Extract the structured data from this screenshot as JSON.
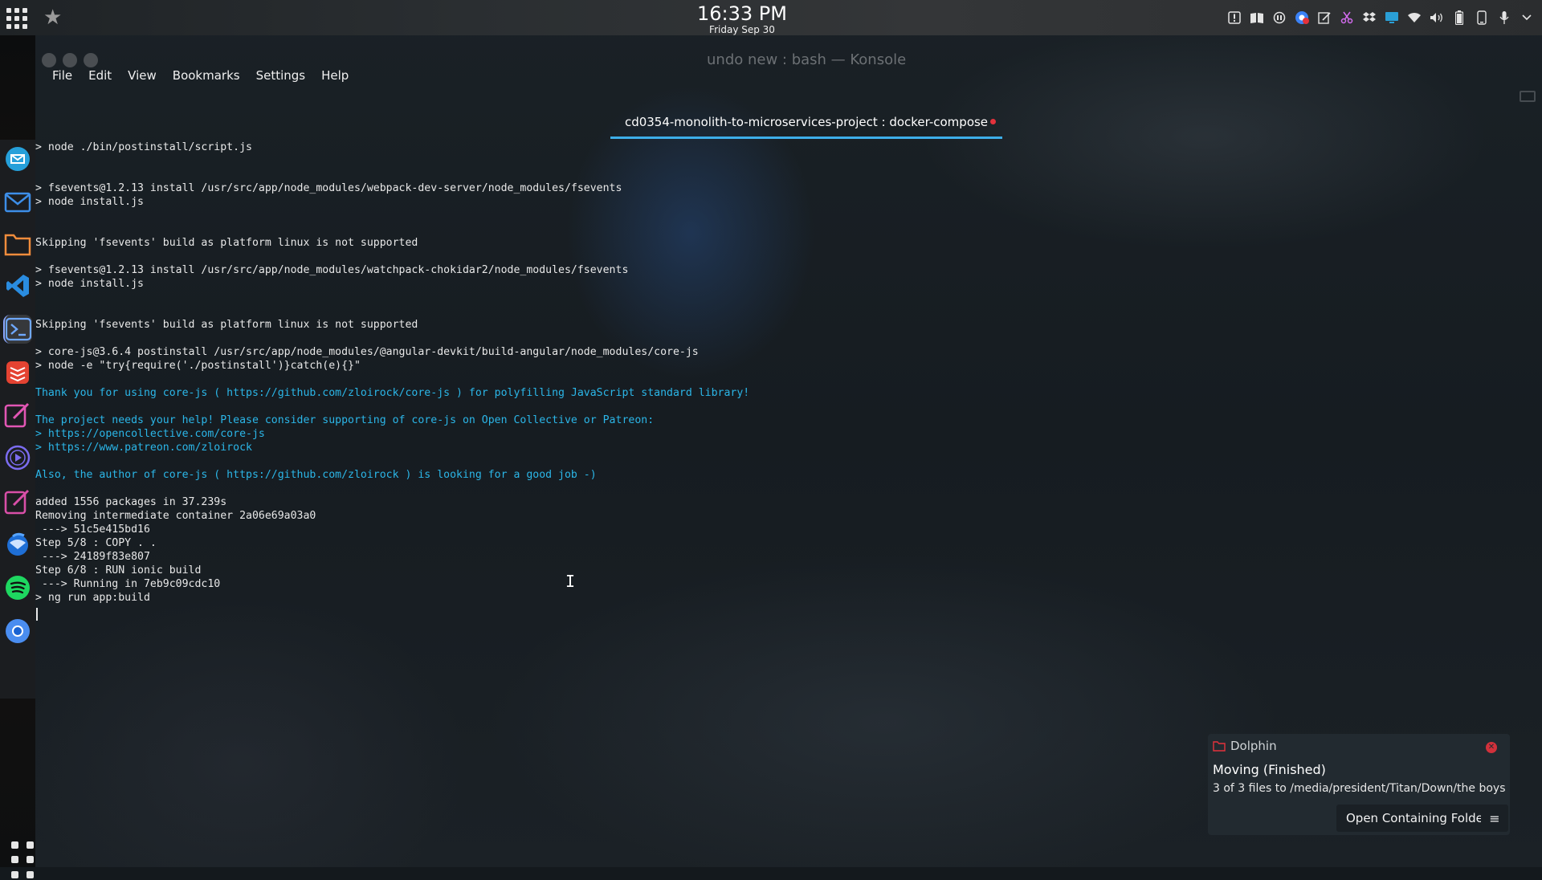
{
  "top_panel": {
    "time": "16:33 PM",
    "date": "Friday Sep 30",
    "tray_icons": [
      "alert-icon",
      "book-icon",
      "media-icon",
      "chrome-badge-icon",
      "notes-icon",
      "scissors-icon",
      "dropbox-icon",
      "display-icon",
      "wifi-icon",
      "volume-icon",
      "battery-icon",
      "phone-icon",
      "microphone-icon",
      "chevron-down-icon"
    ]
  },
  "dock": {
    "items": [
      "mail-client-icon",
      "mail-icon",
      "files-icon",
      "vscode-icon",
      "terminal-icon",
      "todoist-icon",
      "notes-pen-icon",
      "media-player-icon",
      "draw-icon",
      "thunderbird-icon",
      "spotify-icon",
      "chromium-icon"
    ]
  },
  "window": {
    "title": "undo new : bash — Konsole",
    "menu": [
      "File",
      "Edit",
      "View",
      "Bookmarks",
      "Settings",
      "Help"
    ],
    "tab_label": "cd0354-monolith-to-microservices-project : docker-compose"
  },
  "terminal": {
    "lines": [
      {
        "text": "> node ./bin/postinstall/script.js",
        "style": "plain"
      },
      {
        "text": "> fsevents@1.2.13 install /usr/src/app/node_modules/webpack-dev-server/node_modules/fsevents",
        "style": "plain"
      },
      {
        "text": "> node install.js",
        "style": "plain"
      },
      {
        "text": "Skipping 'fsevents' build as platform linux is not supported",
        "style": "plain"
      },
      {
        "text": "> fsevents@1.2.13 install /usr/src/app/node_modules/watchpack-chokidar2/node_modules/fsevents",
        "style": "plain"
      },
      {
        "text": "> node install.js",
        "style": "plain"
      },
      {
        "text": "Skipping 'fsevents' build as platform linux is not supported",
        "style": "plain"
      },
      {
        "text": "> core-js@3.6.4 postinstall /usr/src/app/node_modules/@angular-devkit/build-angular/node_modules/core-js",
        "style": "plain"
      },
      {
        "text": "> node -e \"try{require('./postinstall')}catch(e){}\"",
        "style": "plain"
      },
      {
        "text": "Thank you for using core-js ( https://github.com/zloirock/core-js ) for polyfilling JavaScript standard library!",
        "style": "cyan"
      },
      {
        "text": "The project needs your help! Please consider supporting of core-js on Open Collective or Patreon:",
        "style": "cyan"
      },
      {
        "text": "> https://opencollective.com/core-js",
        "style": "cyan"
      },
      {
        "text": "> https://www.patreon.com/zloirock",
        "style": "cyan"
      },
      {
        "text": "Also, the author of core-js ( https://github.com/zloirock ) is looking for a good job -)",
        "style": "cyan"
      },
      {
        "text": "added 1556 packages in 37.239s",
        "style": "plain"
      },
      {
        "text": "Removing intermediate container 2a06e69a03a0",
        "style": "plain"
      },
      {
        "text": " ---> 51c5e415bd16",
        "style": "plain"
      },
      {
        "text": "Step 5/8 : COPY . .",
        "style": "plain"
      },
      {
        "text": " ---> 24189f83e807",
        "style": "plain"
      },
      {
        "text": "Step 6/8 : RUN ionic build",
        "style": "plain"
      },
      {
        "text": " ---> Running in 7eb9c09cdc10",
        "style": "plain"
      },
      {
        "text": "> ng run app:build",
        "style": "plain"
      }
    ]
  },
  "notification": {
    "app_name": "Dolphin",
    "title": "Moving (Finished)",
    "body": "3 of 3 files to /media/president/Titan/Down/the boys",
    "action_label": "Open Containing Folder"
  },
  "colors": {
    "terminal_text": "#e8e8e8",
    "terminal_cyan": "#2bb6e8",
    "tab_accent": "#3daee9",
    "unsaved_dot": "#e3323c"
  }
}
